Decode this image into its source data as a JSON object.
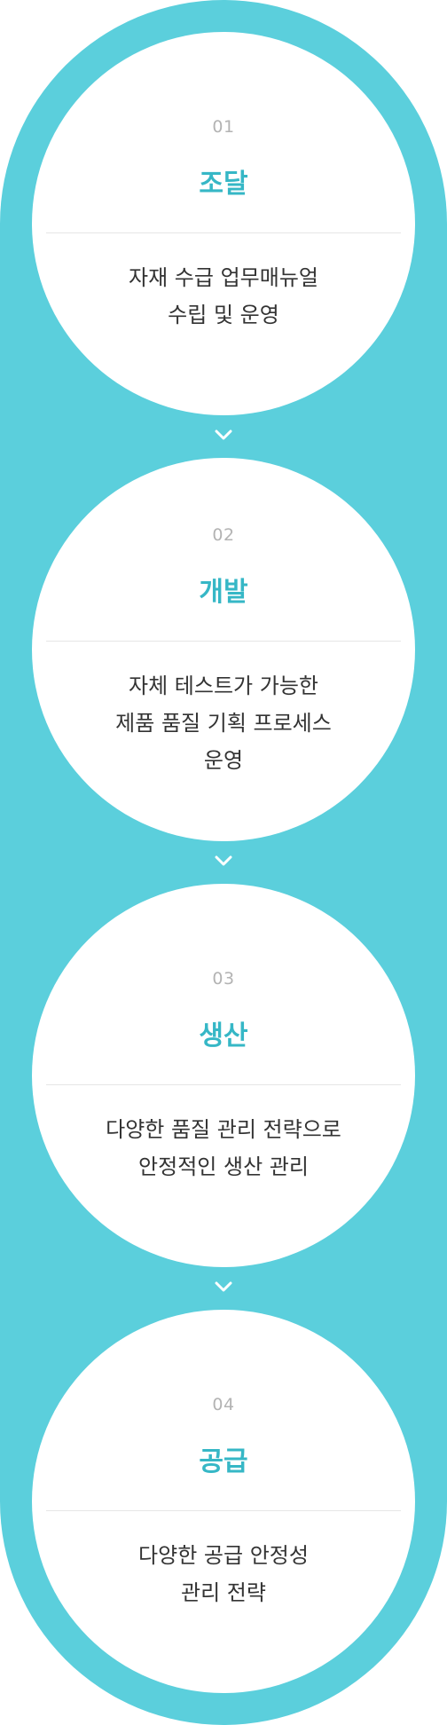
{
  "steps": [
    {
      "number": "01",
      "title": "조달",
      "lines": [
        "자재 수급 업무매뉴얼",
        "수립 및 운영"
      ]
    },
    {
      "number": "02",
      "title": "개발",
      "lines": [
        "자체 테스트가 가능한",
        "제품 품질 기획 프로세스",
        "운영"
      ]
    },
    {
      "number": "03",
      "title": "생산",
      "lines": [
        "다양한 품질 관리 전략으로",
        "안정적인 생산 관리"
      ]
    },
    {
      "number": "04",
      "title": "공급",
      "lines": [
        "다양한 공급 안정성",
        "관리 전략"
      ]
    }
  ],
  "colors": {
    "track": "#5bcfdc",
    "title": "#36b7c6",
    "number": "#b3b3b3",
    "text": "#333333"
  },
  "icons": {
    "connector": "chevron-down-icon"
  }
}
